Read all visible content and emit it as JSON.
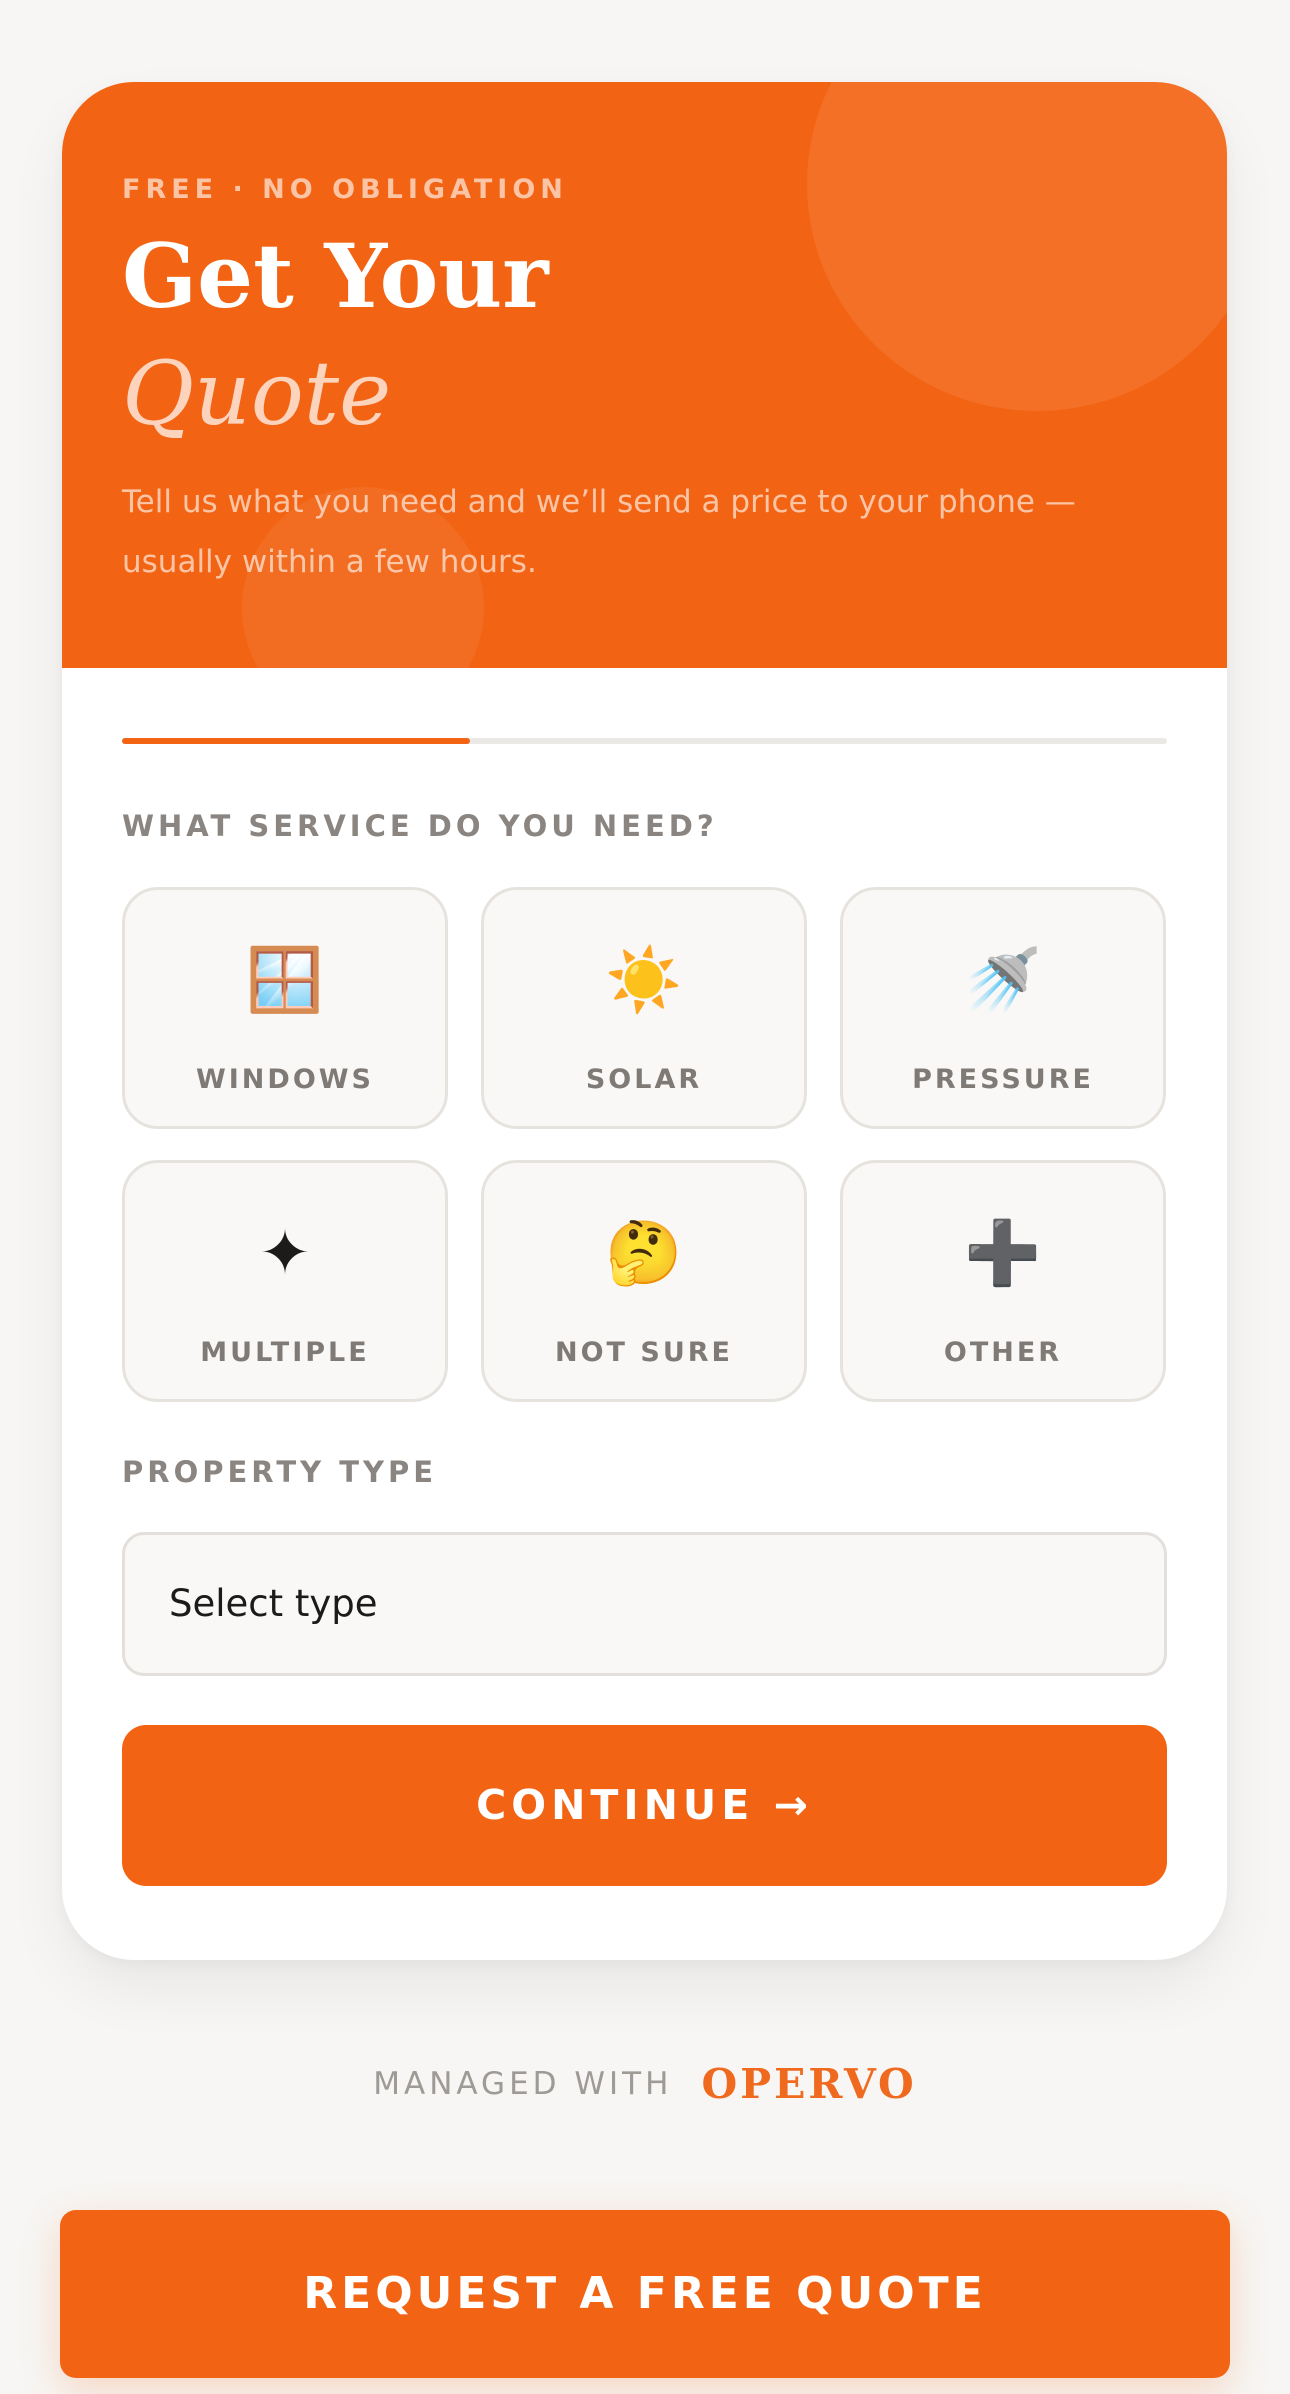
{
  "hero": {
    "eyebrow": "FREE · NO OBLIGATION",
    "title_line1": "Get Your",
    "title_line2": "Quote",
    "subtitle": "Tell us what you need and we’ll send a price to your phone — usually within a few hours."
  },
  "progress": {
    "fraction": 0.333
  },
  "service": {
    "label": "WHAT SERVICE DO YOU NEED?",
    "options": [
      {
        "label": "WINDOWS",
        "icon": "🪟",
        "icon_name": "window-icon"
      },
      {
        "label": "SOLAR",
        "icon": "☀️",
        "icon_name": "sun-icon"
      },
      {
        "label": "PRESSURE",
        "icon": "🚿",
        "icon_name": "shower-icon"
      },
      {
        "label": "MULTIPLE",
        "icon": "✦",
        "icon_name": "sparkle-icon"
      },
      {
        "label": "NOT SURE",
        "icon": "🤔",
        "icon_name": "thinking-face-icon"
      },
      {
        "label": "OTHER",
        "icon": "➕",
        "icon_name": "plus-icon"
      }
    ]
  },
  "property": {
    "label": "PROPERTY TYPE",
    "selected": "Select type"
  },
  "continue_label": "CONTINUE →",
  "footer": {
    "managed_label": "MANAGED WITH",
    "brand": "OPERVO"
  },
  "cta_label": "REQUEST A FREE QUOTE",
  "colors": {
    "accent": "#f26414",
    "background": "#f7f6f4",
    "muted_text": "#8a8580"
  }
}
